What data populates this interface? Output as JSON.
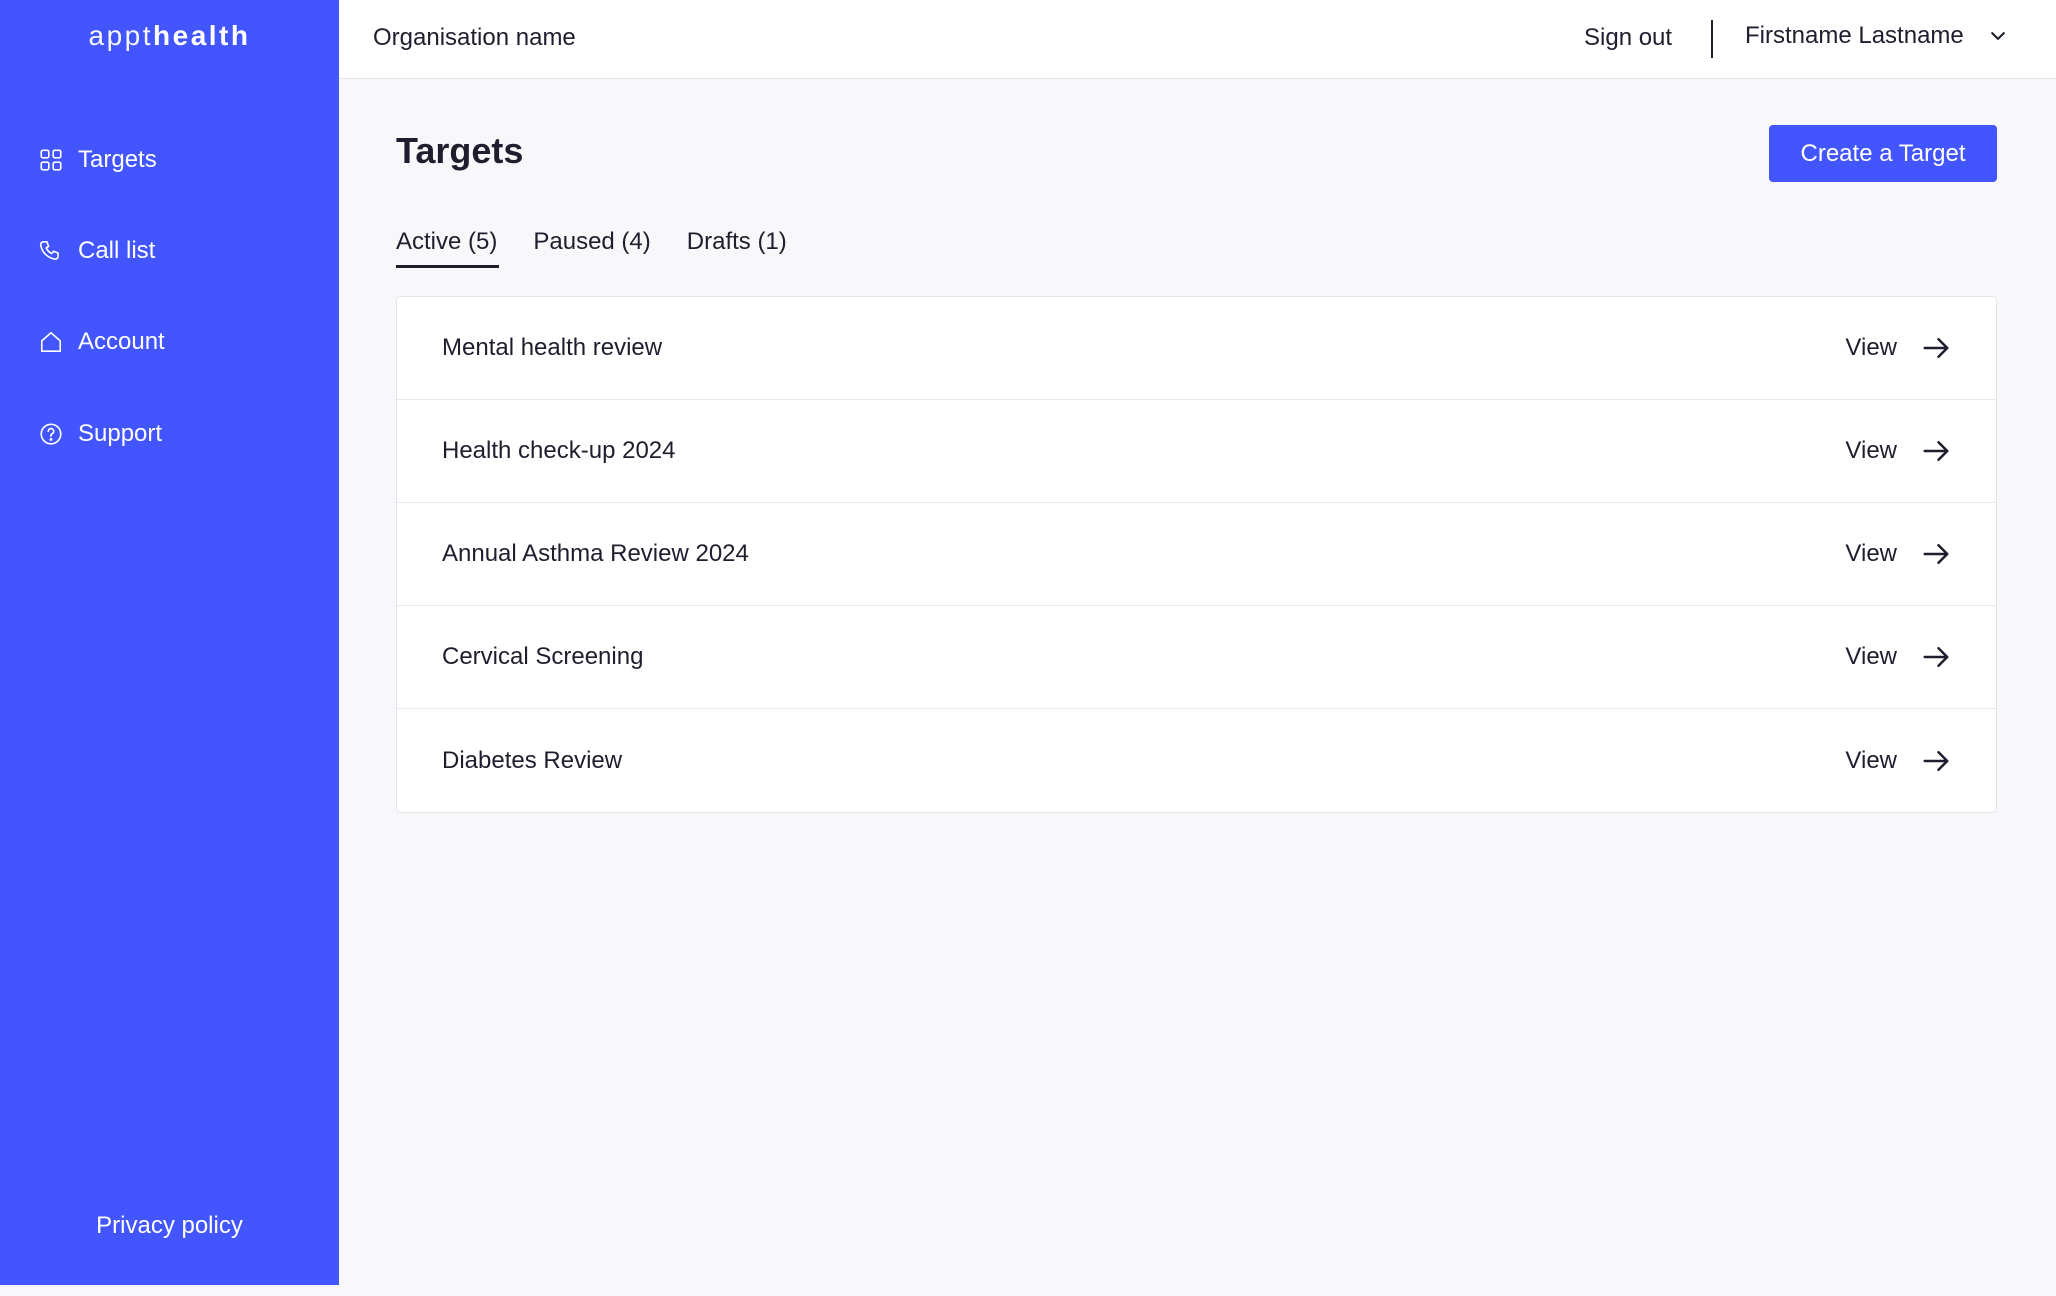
{
  "brand": {
    "light": "appt",
    "bold": "health"
  },
  "sidebar": {
    "items": [
      {
        "label": "Targets",
        "icon": "grid-icon"
      },
      {
        "label": "Call list",
        "icon": "phone-icon"
      },
      {
        "label": "Account",
        "icon": "home-icon"
      },
      {
        "label": "Support",
        "icon": "help-circle-icon"
      }
    ],
    "privacy_label": "Privacy policy"
  },
  "header": {
    "org_name": "Organisation name",
    "sign_out_label": "Sign out",
    "user_name": "Firstname Lastname"
  },
  "main": {
    "title": "Targets",
    "create_label": "Create a Target",
    "tabs": [
      {
        "label": "Active (5)",
        "active": true
      },
      {
        "label": "Paused (4)",
        "active": false
      },
      {
        "label": "Drafts (1)",
        "active": false
      }
    ],
    "targets": [
      {
        "name": "Mental health review",
        "action": "View"
      },
      {
        "name": "Health check-up 2024",
        "action": "View"
      },
      {
        "name": "Annual Asthma Review 2024",
        "action": "View"
      },
      {
        "name": "Cervical Screening",
        "action": "View"
      },
      {
        "name": "Diabetes Review",
        "action": "View"
      }
    ]
  },
  "colors": {
    "brand": "#4255fe",
    "text": "#1e1e2e",
    "background": "#f8f8fa"
  }
}
